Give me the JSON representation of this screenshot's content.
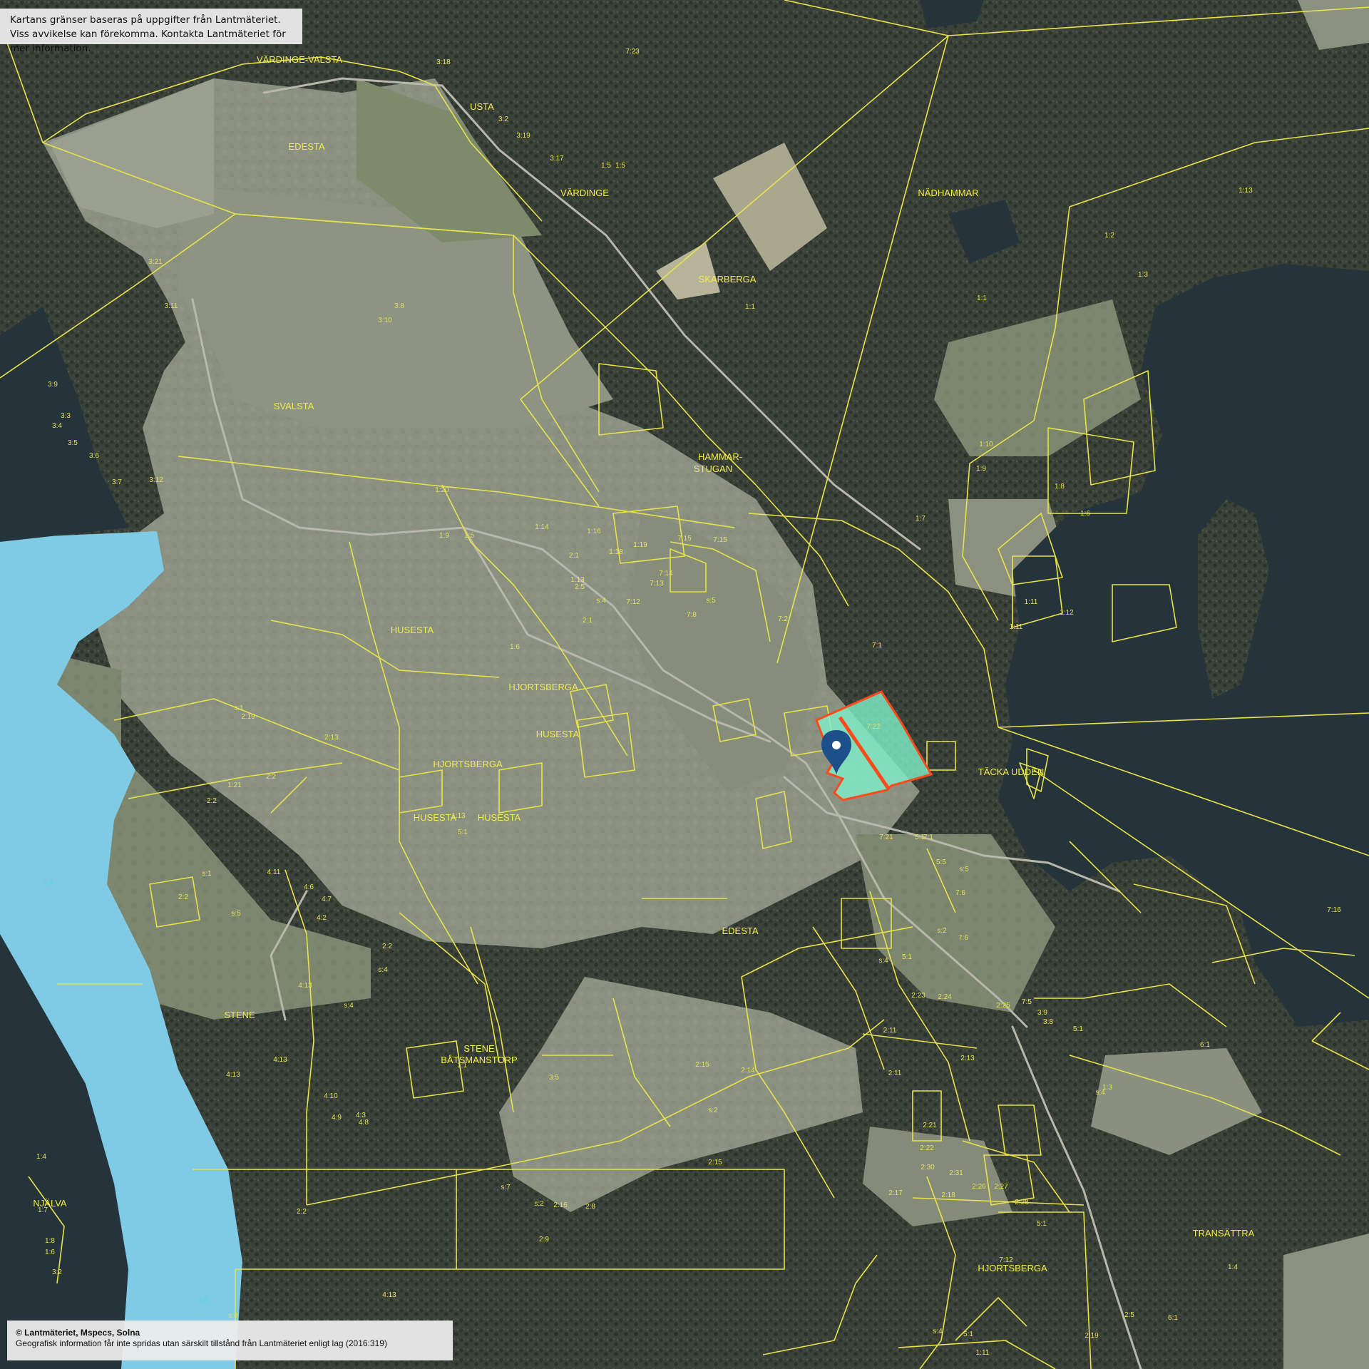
{
  "notices": {
    "top_line1": "Kartans gränser baseras på uppgifter från Lantmäteriet.",
    "top_line2": "Viss avvikelse kan förekomma. Kontakta Lantmäteriet för mer information.",
    "bottom_line1": "© Lantmäteriet, Mspecs, Solna",
    "bottom_line2": "Geografisk information får inte spridas utan särskilt tillstånd från Lantmäteriet enligt lag (2016:319)"
  },
  "colors": {
    "boundary": "#e8e24a",
    "highlight_outline": "#ff4a1c",
    "highlight_fill": "#7ff0c8",
    "marker": "#1d4f8a",
    "water_lake": "#7fcbe6",
    "water_dark": "#25343a"
  },
  "marker": {
    "icon": "location-pin-icon"
  },
  "place_names": [
    "VÄRDINGE-VALSTA",
    "EDESTA",
    "USTA",
    "VÄRDINGE",
    "NÄDHAMMAR",
    "SKARBERGA",
    "SVALSTA",
    "HAMMAR-",
    "STUGAN",
    "HUSESTA",
    "HJORTSBERGA",
    "HUSESTA",
    "HJORTSBERGA",
    "HUSESTA",
    "HUSESTA",
    "TÄCKA UDDEN",
    "EDESTA",
    "STENE",
    "STENE",
    "BÅTSMANSTORP",
    "NJÄLVA",
    "TRANSÄTTRA",
    "HJORTSBERGA"
  ],
  "parcel_labels": [
    "3:18",
    "7:23",
    "3:2",
    "3:19",
    "3:17",
    "1:5",
    "1:5",
    "1:13",
    "1:2",
    "1:3",
    "1:1",
    "1:1",
    "3:21",
    "3:11",
    "3:8",
    "3:10",
    "3:9",
    "3:3",
    "3:4",
    "3:5",
    "3:6",
    "3:7",
    "3:12",
    "1:10",
    "1:9",
    "1:7",
    "1:8",
    "1:6",
    "1:11",
    "1:12",
    "1:11",
    "1:20",
    "1:9",
    "1:5",
    "1:14",
    "1:16",
    "1:18",
    "1:19",
    "7:15",
    "7:15",
    "2:1",
    "1:13",
    "2:5",
    "s:4",
    "2:1",
    "7:12",
    "7:13",
    "7:14",
    "s:5",
    "7:8",
    "7:2",
    "7:1",
    "7:22",
    "7:21",
    "5:1",
    "7:1",
    "5:5",
    "s:5",
    "7:6",
    "s:2",
    "7:6",
    "7:16",
    "1:6",
    "2:19",
    "2:13",
    "2:2",
    "2:2",
    "s:1",
    "2:2",
    "s:5",
    "4:11",
    "4:6",
    "4:7",
    "4:2",
    "2:2",
    "s:4",
    "4:13",
    "s:4",
    "4:13",
    "4:10",
    "4:9",
    "4:3",
    "4:8",
    "4:13",
    "1:1",
    "3:5",
    "2:15",
    "2:14",
    "s:2",
    "2:15",
    "s:7",
    "s:2",
    "2:16",
    "2:8",
    "2:9",
    "2:2",
    "4:13",
    "s:8",
    "5:1",
    "s:4",
    "2:23",
    "2:24",
    "2:11",
    "2:11",
    "2:13",
    "2:25",
    "7:5",
    "3:9",
    "3:8",
    "5:1",
    "2:21",
    "2:22",
    "2:30",
    "2:31",
    "2:17",
    "2:18",
    "2:26",
    "2:27",
    "2:28",
    "5:1",
    "7:12",
    "1:4",
    "s:4",
    "5:1",
    "1:11",
    "2:5",
    "2:19",
    "6:1",
    "6:1",
    "s:4",
    "1:3",
    "1:4",
    "1:7",
    "1:8",
    "1:6",
    "3:2",
    "s:1",
    "1:21",
    "1:13",
    "5:1"
  ],
  "water_labels": [
    "s:8",
    "s:8"
  ]
}
